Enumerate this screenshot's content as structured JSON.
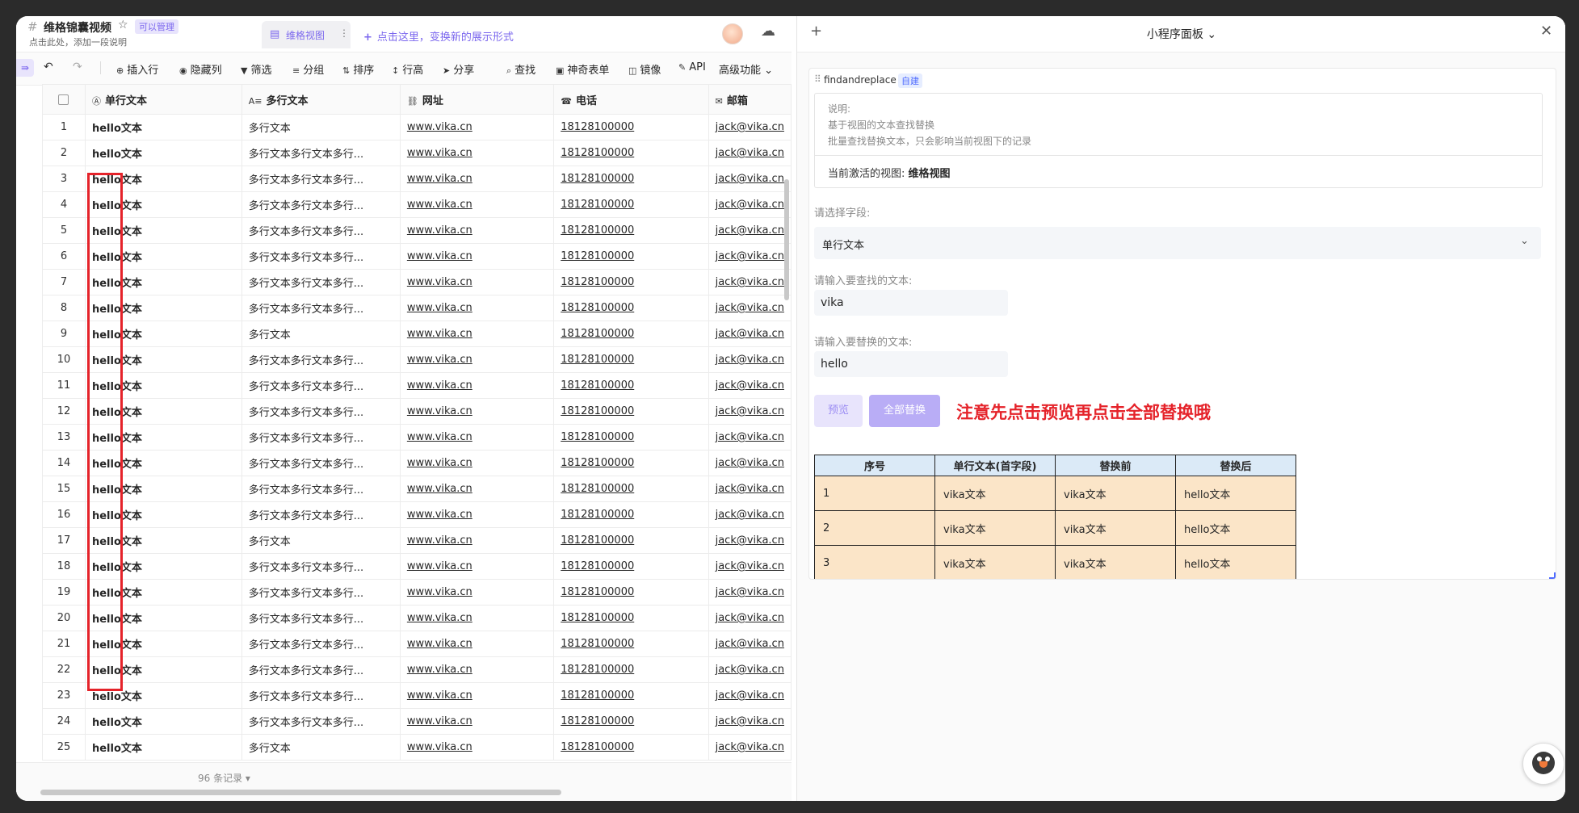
{
  "title": {
    "name": "维格锦囊视频",
    "badge": "可以管理",
    "description": "点击此处，添加一段说明"
  },
  "view_tab": {
    "label": "维格视图"
  },
  "add_view": "点击这里，变换新的展示形式",
  "toolbar": {
    "insert_row": "插入行",
    "hide_cols": "隐藏列",
    "filter": "筛选",
    "group": "分组",
    "sort": "排序",
    "row_height": "行高",
    "share": "分享",
    "find": "查找",
    "form": "神奇表单",
    "mirror": "镜像",
    "api": "API",
    "advanced": "高级功能"
  },
  "grid": {
    "columns": [
      "单行文本",
      "多行文本",
      "网址",
      "电话",
      "邮箱"
    ],
    "rows": [
      {
        "num": "1",
        "single": "hello文本",
        "multi": "多行文本",
        "url": "www.vika.cn",
        "phone": "18128100000",
        "email": "jack@vika.cn"
      },
      {
        "num": "2",
        "single": "hello文本",
        "multi": "多行文本多行文本多行...",
        "url": "www.vika.cn",
        "phone": "18128100000",
        "email": "jack@vika.cn"
      },
      {
        "num": "3",
        "single": "hello文本",
        "multi": "多行文本多行文本多行...",
        "url": "www.vika.cn",
        "phone": "18128100000",
        "email": "jack@vika.cn"
      },
      {
        "num": "4",
        "single": "hello文本",
        "multi": "多行文本多行文本多行...",
        "url": "www.vika.cn",
        "phone": "18128100000",
        "email": "jack@vika.cn"
      },
      {
        "num": "5",
        "single": "hello文本",
        "multi": "多行文本多行文本多行...",
        "url": "www.vika.cn",
        "phone": "18128100000",
        "email": "jack@vika.cn"
      },
      {
        "num": "6",
        "single": "hello文本",
        "multi": "多行文本多行文本多行...",
        "url": "www.vika.cn",
        "phone": "18128100000",
        "email": "jack@vika.cn"
      },
      {
        "num": "7",
        "single": "hello文本",
        "multi": "多行文本多行文本多行...",
        "url": "www.vika.cn",
        "phone": "18128100000",
        "email": "jack@vika.cn"
      },
      {
        "num": "8",
        "single": "hello文本",
        "multi": "多行文本多行文本多行...",
        "url": "www.vika.cn",
        "phone": "18128100000",
        "email": "jack@vika.cn"
      },
      {
        "num": "9",
        "single": "hello文本",
        "multi": "多行文本",
        "url": "www.vika.cn",
        "phone": "18128100000",
        "email": "jack@vika.cn"
      },
      {
        "num": "10",
        "single": "hello文本",
        "multi": "多行文本多行文本多行...",
        "url": "www.vika.cn",
        "phone": "18128100000",
        "email": "jack@vika.cn"
      },
      {
        "num": "11",
        "single": "hello文本",
        "multi": "多行文本多行文本多行...",
        "url": "www.vika.cn",
        "phone": "18128100000",
        "email": "jack@vika.cn"
      },
      {
        "num": "12",
        "single": "hello文本",
        "multi": "多行文本多行文本多行...",
        "url": "www.vika.cn",
        "phone": "18128100000",
        "email": "jack@vika.cn"
      },
      {
        "num": "13",
        "single": "hello文本",
        "multi": "多行文本多行文本多行...",
        "url": "www.vika.cn",
        "phone": "18128100000",
        "email": "jack@vika.cn"
      },
      {
        "num": "14",
        "single": "hello文本",
        "multi": "多行文本多行文本多行...",
        "url": "www.vika.cn",
        "phone": "18128100000",
        "email": "jack@vika.cn"
      },
      {
        "num": "15",
        "single": "hello文本",
        "multi": "多行文本多行文本多行...",
        "url": "www.vika.cn",
        "phone": "18128100000",
        "email": "jack@vika.cn"
      },
      {
        "num": "16",
        "single": "hello文本",
        "multi": "多行文本多行文本多行...",
        "url": "www.vika.cn",
        "phone": "18128100000",
        "email": "jack@vika.cn"
      },
      {
        "num": "17",
        "single": "hello文本",
        "multi": "多行文本",
        "url": "www.vika.cn",
        "phone": "18128100000",
        "email": "jack@vika.cn"
      },
      {
        "num": "18",
        "single": "hello文本",
        "multi": "多行文本多行文本多行...",
        "url": "www.vika.cn",
        "phone": "18128100000",
        "email": "jack@vika.cn"
      },
      {
        "num": "19",
        "single": "hello文本",
        "multi": "多行文本多行文本多行...",
        "url": "www.vika.cn",
        "phone": "18128100000",
        "email": "jack@vika.cn"
      },
      {
        "num": "20",
        "single": "hello文本",
        "multi": "多行文本多行文本多行...",
        "url": "www.vika.cn",
        "phone": "18128100000",
        "email": "jack@vika.cn"
      },
      {
        "num": "21",
        "single": "hello文本",
        "multi": "多行文本多行文本多行...",
        "url": "www.vika.cn",
        "phone": "18128100000",
        "email": "jack@vika.cn"
      },
      {
        "num": "22",
        "single": "hello文本",
        "multi": "多行文本多行文本多行...",
        "url": "www.vika.cn",
        "phone": "18128100000",
        "email": "jack@vika.cn"
      },
      {
        "num": "23",
        "single": "hello文本",
        "multi": "多行文本多行文本多行...",
        "url": "www.vika.cn",
        "phone": "18128100000",
        "email": "jack@vika.cn"
      },
      {
        "num": "24",
        "single": "hello文本",
        "multi": "多行文本多行文本多行...",
        "url": "www.vika.cn",
        "phone": "18128100000",
        "email": "jack@vika.cn"
      },
      {
        "num": "25",
        "single": "hello文本",
        "multi": "多行文本",
        "url": "www.vika.cn",
        "phone": "18128100000",
        "email": "jack@vika.cn"
      }
    ]
  },
  "footer": {
    "record_count": "96 条记录 ▾"
  },
  "panel": {
    "title": "小程序面板",
    "widget": {
      "name": "findandreplace",
      "badge": "自建",
      "info_label": "说明:",
      "info_line1": "基于视图的文本查找替换",
      "info_line2": "批量查找替换文本，只会影响当前视图下的记录",
      "active_view_label": "当前激活的视图:",
      "active_view_value": "维格视图",
      "field_label": "请选择字段:",
      "field_value": "单行文本",
      "find_label": "请输入要查找的文本:",
      "find_value": "vika",
      "replace_label": "请输入要替换的文本:",
      "replace_value": "hello",
      "preview_button": "预览",
      "replace_all_button": "全部替换",
      "notice": "注意先点击预览再点击全部替换哦",
      "preview_table": {
        "headers": [
          "序号",
          "单行文本(首字段)",
          "替换前",
          "替换后"
        ],
        "rows": [
          [
            "1",
            "vika文本",
            "vika文本",
            "hello文本"
          ],
          [
            "2",
            "vika文本",
            "vika文本",
            "hello文本"
          ],
          [
            "3",
            "vika文本",
            "vika文本",
            "hello文本"
          ]
        ]
      }
    }
  },
  "accent_color": "#7b67ee",
  "annotation_color": "#e5232a"
}
